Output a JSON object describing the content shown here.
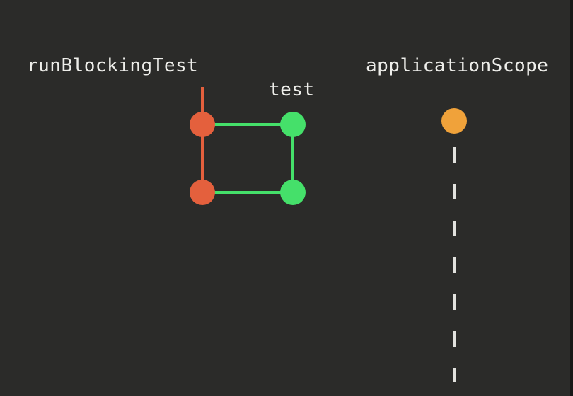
{
  "labels": {
    "run_blocking_test": "runBlockingTest",
    "test": "test",
    "application_scope": "applicationScope"
  },
  "colors": {
    "background": "#2b2b29",
    "run_blocking_test": "#e4603d",
    "test": "#45e06a",
    "application_scope": "#f0a23a",
    "label_text": "#eeeeea"
  }
}
